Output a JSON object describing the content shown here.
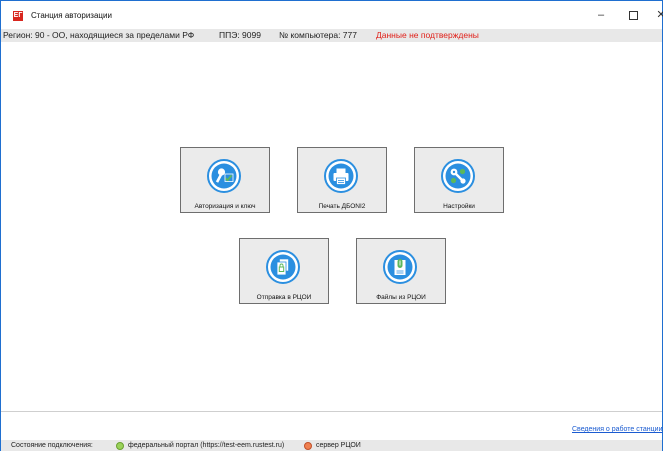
{
  "window": {
    "title": "Станция авторизации",
    "app_icon_glyph": "ЕГ",
    "controls": {
      "minimize": "–",
      "maximize": "",
      "close": "✕"
    }
  },
  "infobar": {
    "region": "Регион: 90 - ОО, находящиеся за пределами РФ",
    "ppe": "ППЭ: 9099",
    "computer": "№ компьютера: 777",
    "warning": "Данные не подтверждены",
    "warning_color": "#e0201a"
  },
  "tiles": [
    {
      "label": "Авторизация и ключ",
      "icon": "key-check-icon"
    },
    {
      "label": "Печать ДБОNI2",
      "icon": "printer-icon"
    },
    {
      "label": "Настройки",
      "icon": "settings-icon"
    },
    {
      "label": "Отправка в РЦОИ",
      "icon": "send-package-icon"
    },
    {
      "label": "Файлы из РЦОИ",
      "icon": "files-download-icon"
    }
  ],
  "footer": {
    "about_link": "Сведения о работе станции",
    "status_label": "Состояние подключения:",
    "federal_portal": "федеральный портал (https://test-eem.rustest.ru)",
    "federal_status_color": "#9ad25a",
    "rcoi_server": "сервер РЦОИ",
    "rcoi_status_color": "#f08050"
  },
  "colors": {
    "accent": "#2b8fe0",
    "icon_check": "#5cb85c"
  }
}
